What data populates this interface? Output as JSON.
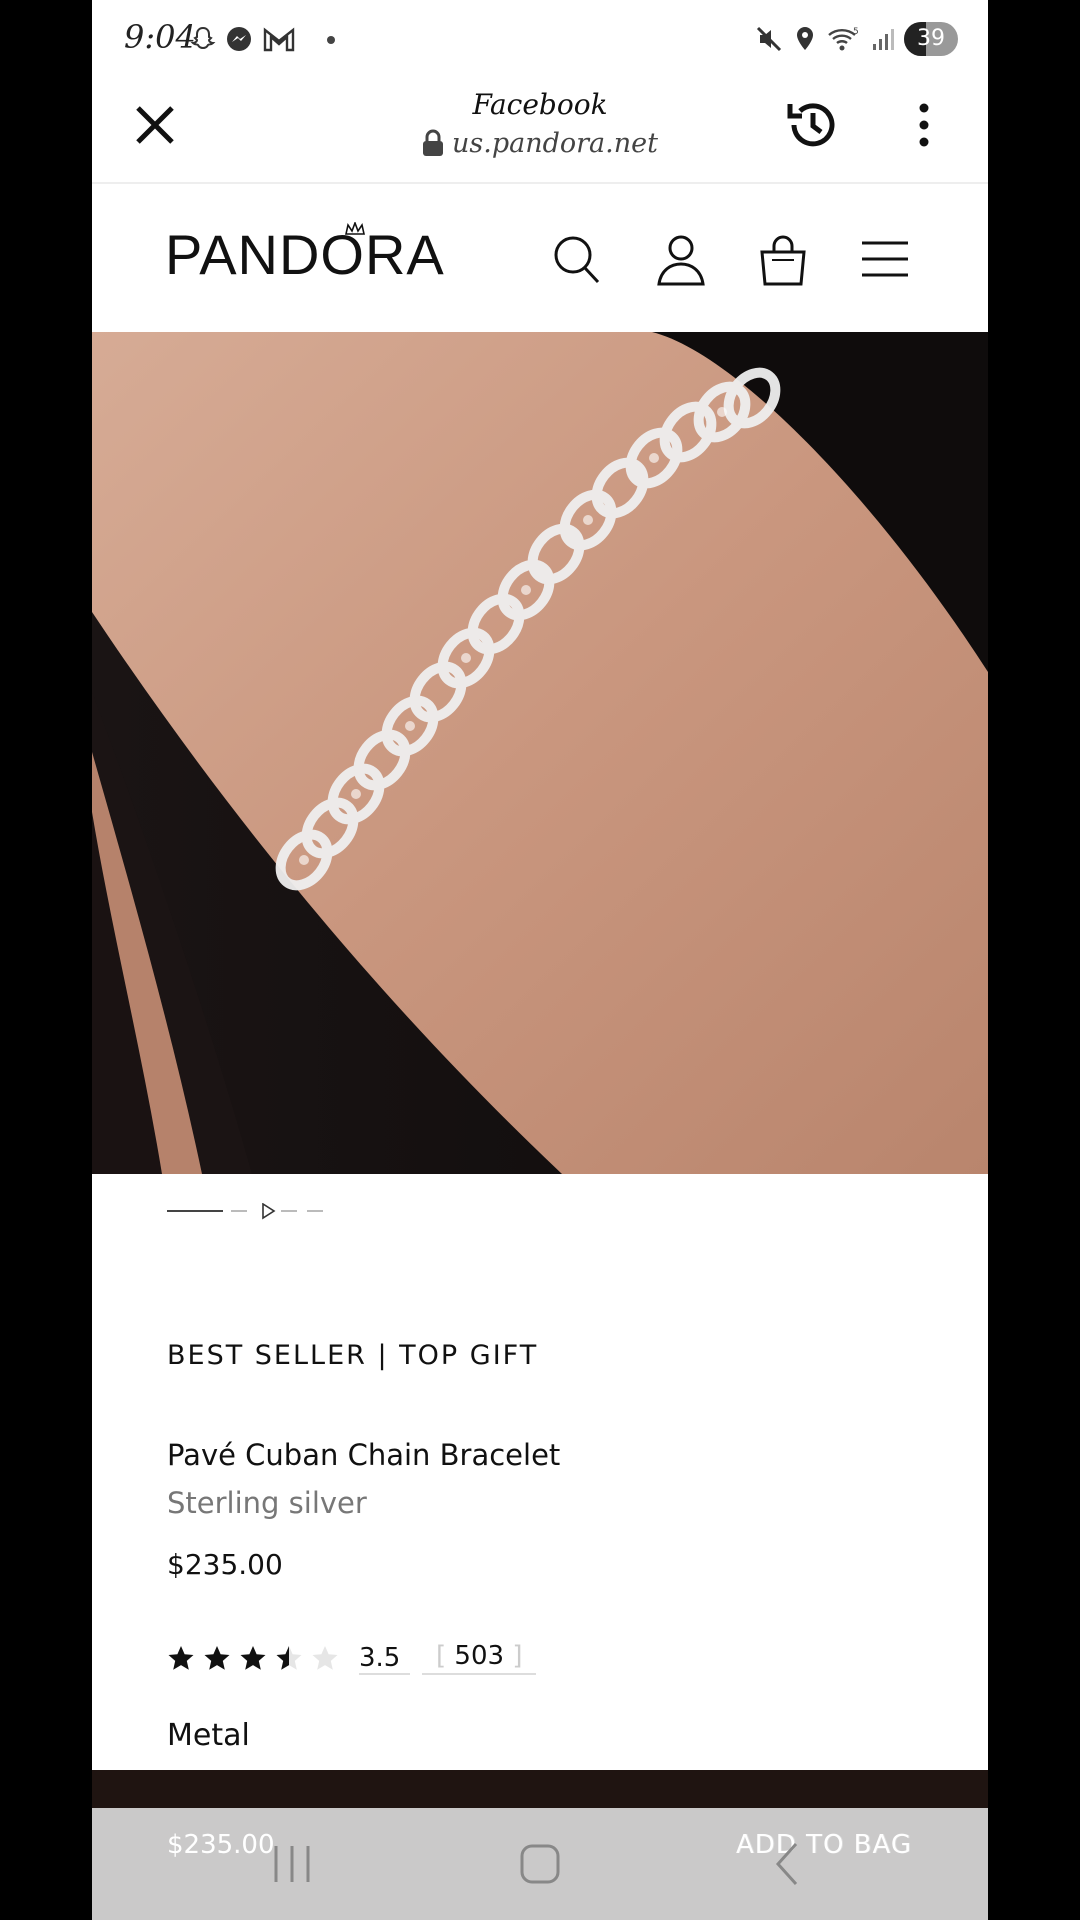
{
  "status_bar": {
    "time": "9:04",
    "battery": "39",
    "left_icons": [
      "snapchat-icon",
      "messenger-icon",
      "gmail-icon",
      "dot-icon"
    ],
    "right_icons": [
      "mute-icon",
      "location-icon",
      "wifi-icon",
      "signal-icon",
      "battery-icon"
    ]
  },
  "custom_tab": {
    "title": "Facebook",
    "url": "us.pandora.net"
  },
  "site_header": {
    "logo": "PANDORA",
    "icons": [
      "search-icon",
      "account-icon",
      "bag-icon",
      "menu-icon"
    ]
  },
  "product": {
    "badge": "BEST SELLER | TOP GIFT",
    "name": "Pavé Cuban Chain Bracelet",
    "material": "Sterling silver",
    "price": "$235.00",
    "rating": 3.5,
    "rating_text": "3.5",
    "review_count": "503",
    "option_label": "Metal"
  },
  "sticky_bar": {
    "price": "$235.00",
    "add_to_bag": "ADD TO BAG"
  },
  "carousel": {
    "slides": 5,
    "active": 0
  },
  "colors": {
    "brand_dark": "#1f1411",
    "text": "#111111",
    "muted": "#777777"
  }
}
